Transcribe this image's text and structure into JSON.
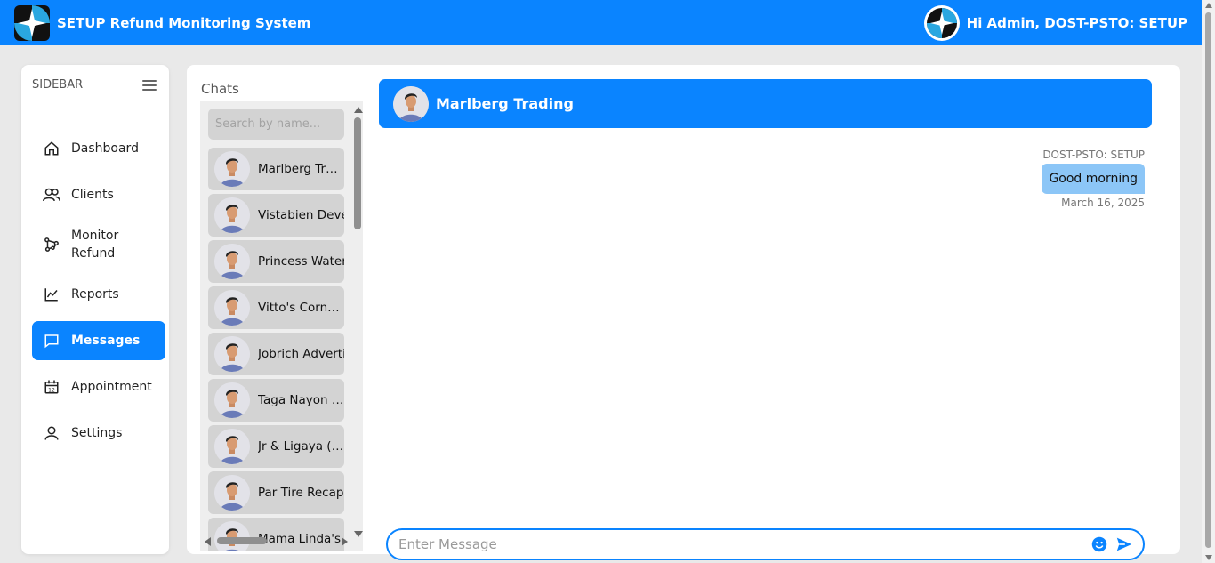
{
  "header": {
    "title": "SETUP Refund Monitoring System",
    "greeting": "Hi Admin, DOST-PSTO: SETUP"
  },
  "sidebar": {
    "title": "SIDEBAR",
    "items": [
      {
        "label": "Dashboard",
        "icon": "home-icon"
      },
      {
        "label": "Clients",
        "icon": "users-icon"
      },
      {
        "label": "Monitor Refund",
        "icon": "network-icon"
      },
      {
        "label": "Reports",
        "icon": "chart-line-icon"
      },
      {
        "label": "Messages",
        "icon": "message-icon",
        "active": true
      },
      {
        "label": "Appointment",
        "icon": "calendar-icon"
      },
      {
        "label": "Settings",
        "icon": "user-icon"
      }
    ]
  },
  "chats": {
    "title": "Chats",
    "search_placeholder": "Search by name...",
    "contacts": [
      "Marlberg Trading",
      "Vistabien Development",
      "Princess Water Station",
      "Vitto's Corner Eatery",
      "Jobrich Advertising",
      "Taga Nayon Enterprise",
      "Jr & Ligaya (Kakanin)",
      "Par Tire Recapping",
      "Mama Linda's Food"
    ]
  },
  "conversation": {
    "name": "Marlberg Trading",
    "messages": [
      {
        "sender": "DOST-PSTO: SETUP",
        "text": "Good morning",
        "date": "March 16, 2025"
      }
    ],
    "input_placeholder": "Enter Message"
  },
  "colors": {
    "primary": "#0a84ff",
    "bubble": "#8cc6f7",
    "contact_bg": "#d3d3d3"
  }
}
